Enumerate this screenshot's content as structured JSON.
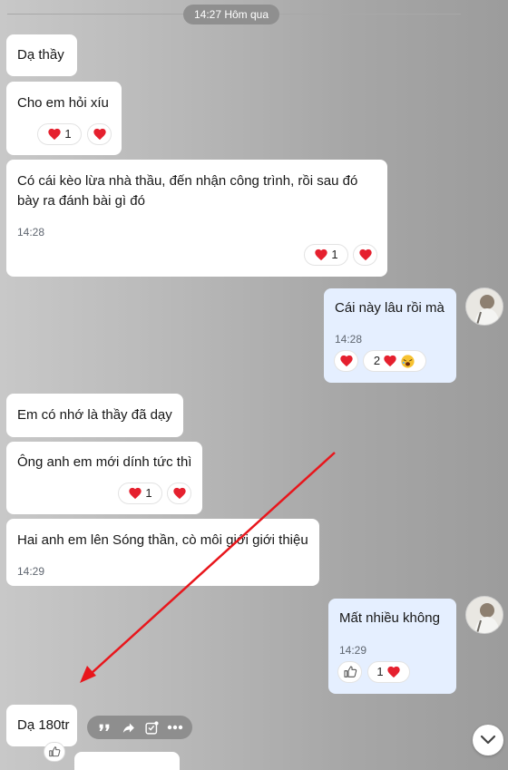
{
  "header": {
    "date_divider": "14:27 Hôm qua"
  },
  "messages": [
    {
      "text": "Dạ thầy"
    },
    {
      "text": "Cho em hỏi xíu",
      "reaction_count": "1"
    },
    {
      "text_line1": "Có cái kèo lừa nhà thầu, đến nhận công trình,  rồi sau đó",
      "text_line2": "bày ra đánh bài gì đó",
      "time": "14:28",
      "reaction_count": "1"
    },
    {
      "text": "Cái này lâu rồi mà",
      "time": "14:28",
      "reaction_count": "2"
    },
    {
      "text": "Em có nhớ là thầy đã dạy"
    },
    {
      "text": "Ông anh em mới dính tức thì",
      "reaction_count": "1"
    },
    {
      "text": "Hai anh em lên Sóng thần, cò môi giới giới thiệu",
      "time": "14:29"
    },
    {
      "text": "Mất nhiều không",
      "time": "14:29",
      "reaction_count": "1"
    },
    {
      "text": "Dạ 180tr"
    }
  ],
  "colors": {
    "mine_bubble": "#e5efff",
    "their_bubble": "#ffffff",
    "heart": "#e5202e",
    "annotation_arrow": "#e8161c"
  },
  "icons": [
    "heart-icon",
    "laughing-face-icon",
    "thumbs-up-icon",
    "quote-icon",
    "share-icon",
    "mark-task-icon",
    "more-icon",
    "chevron-down-icon"
  ]
}
